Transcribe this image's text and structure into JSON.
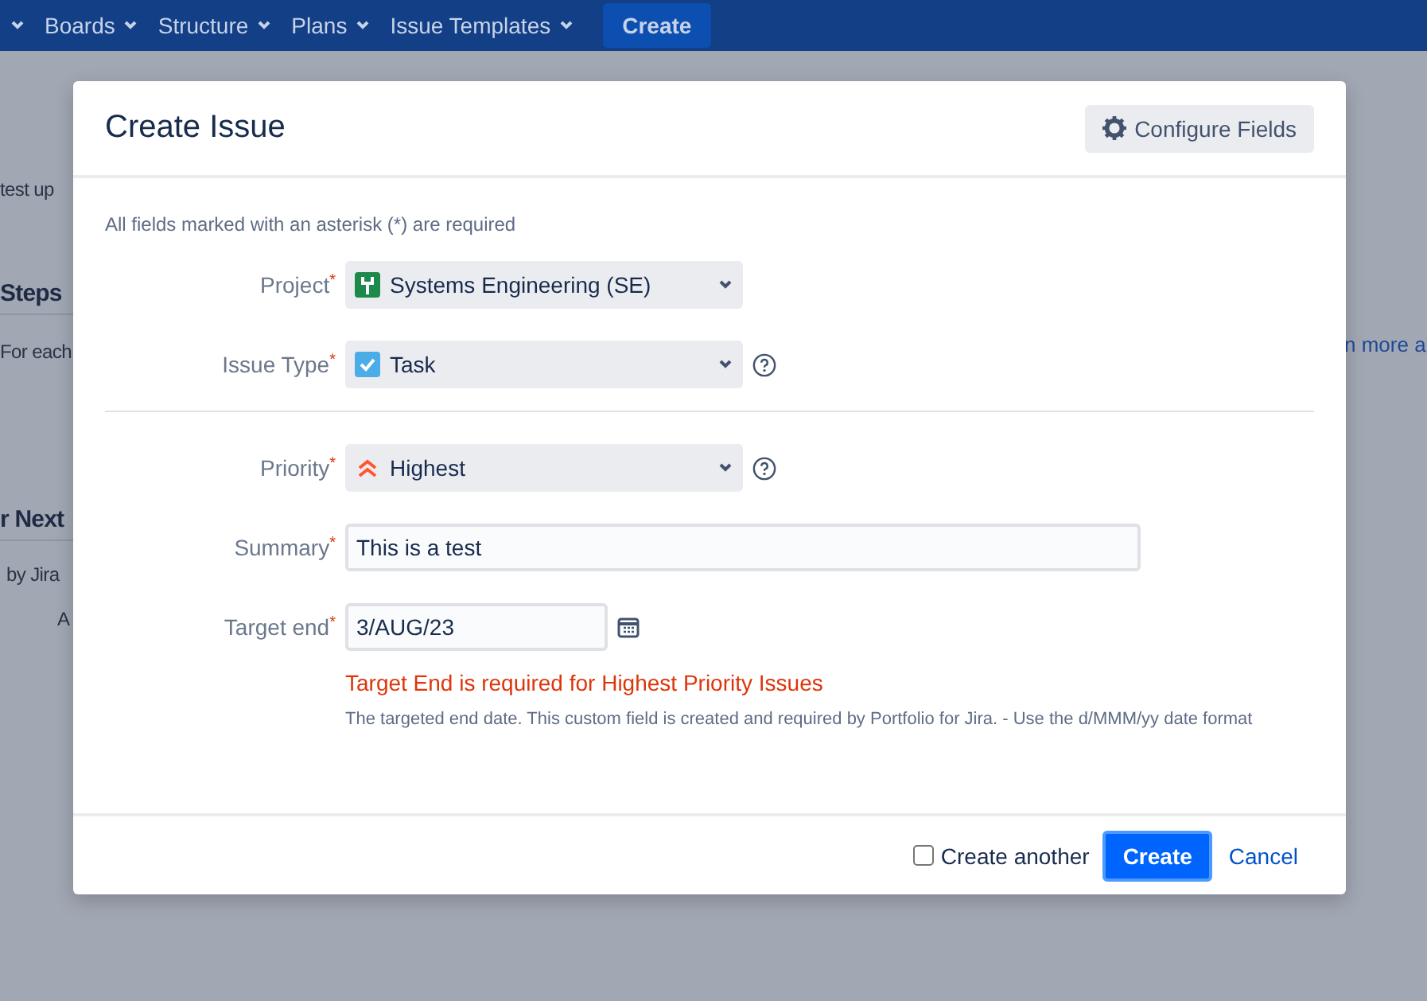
{
  "nav": {
    "items": [
      {
        "dropdown": true
      },
      {
        "label": "Boards",
        "dropdown": true
      },
      {
        "label": "Structure",
        "dropdown": true
      },
      {
        "label": "Plans",
        "dropdown": true
      },
      {
        "label": "Issue Templates",
        "dropdown": true
      }
    ],
    "create_button": "Create"
  },
  "background": {
    "left": [
      {
        "kind": "text",
        "text": "test up"
      },
      {
        "kind": "heading",
        "text": "Steps"
      },
      {
        "kind": "text",
        "text": "For each"
      },
      {
        "kind": "heading",
        "text": "r Next"
      },
      {
        "kind": "text",
        "text": "by Jira"
      },
      {
        "kind": "indent",
        "text": "A"
      }
    ],
    "right_link": "n more a"
  },
  "dialog": {
    "title": "Create Issue",
    "configure_button": "Configure Fields",
    "required_note": "All fields marked with an asterisk (*) are required",
    "fields": [
      {
        "kind": "select",
        "label": "Project",
        "required_mark": "*",
        "value": "Systems Engineering (SE)"
      },
      {
        "kind": "select",
        "label": "Issue Type",
        "required_mark": "*",
        "value": "Task",
        "help": true
      },
      {
        "kind": "divider"
      },
      {
        "kind": "select",
        "label": "Priority",
        "required_mark": "*",
        "value": "Highest",
        "help": true
      },
      {
        "kind": "text",
        "label": "Summary",
        "required_mark": "*",
        "value": "This is a test"
      },
      {
        "kind": "date",
        "label": "Target end",
        "required_mark": "*",
        "value": "3/AUG/23",
        "error": "Target End is required for Highest Priority Issues",
        "description": "The targeted end date. This custom field is created and required by Portfolio for Jira. - Use the d/MMM/yy date format"
      }
    ],
    "create_another": {
      "label": "Create another",
      "checked": false
    },
    "submit_button": "Create",
    "cancel_link": "Cancel"
  }
}
